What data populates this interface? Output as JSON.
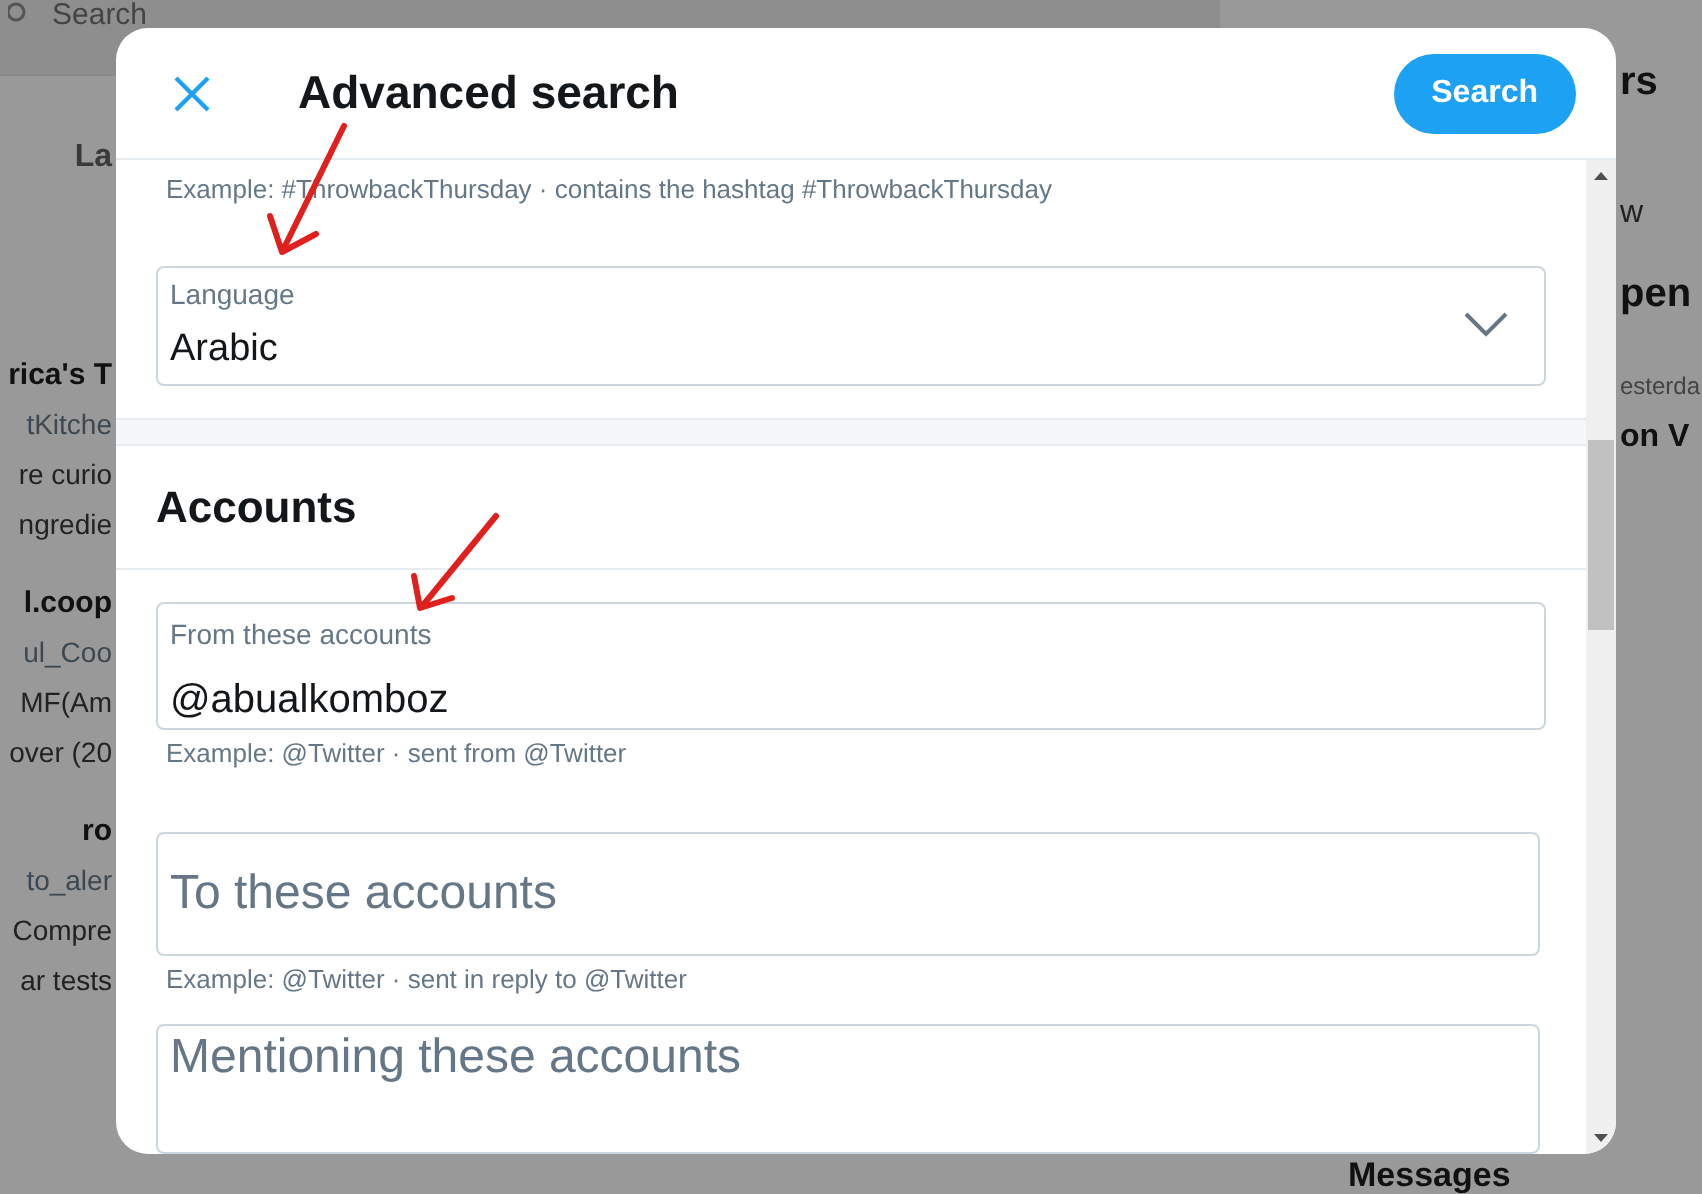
{
  "background": {
    "search_placeholder": "Search",
    "left_texts": [
      {
        "kind": "tab",
        "text": "La"
      },
      {
        "kind": "name",
        "text": "rica's T"
      },
      {
        "kind": "handle",
        "text": "tKitche"
      },
      {
        "kind": "body",
        "text": "re curio"
      },
      {
        "kind": "body",
        "text": "ngredie"
      },
      {
        "kind": "name",
        "text": "l.coop"
      },
      {
        "kind": "handle",
        "text": "ul_Coo"
      },
      {
        "kind": "body",
        "text": "MF(Am"
      },
      {
        "kind": "body",
        "text": "over (20"
      },
      {
        "kind": "verified_name",
        "text": "ro"
      },
      {
        "kind": "handle",
        "text": "to_aler"
      },
      {
        "kind": "body",
        "text": "Compre"
      },
      {
        "kind": "body",
        "text": "ar tests"
      }
    ],
    "right_texts": [
      {
        "kind": "heading",
        "text": "rs"
      },
      {
        "kind": "body",
        "text": "w"
      },
      {
        "kind": "heading",
        "text": "pen"
      },
      {
        "kind": "meta",
        "text": "esterda"
      },
      {
        "kind": "name",
        "text": "on V"
      },
      {
        "kind": "footer",
        "text": "Messages"
      }
    ]
  },
  "dialog": {
    "title": "Advanced search",
    "search_button": "Search",
    "items": [
      {
        "kind": "hint",
        "text": "Example: #ThrowbackThursday · contains the hashtag #ThrowbackThursday"
      },
      {
        "kind": "select",
        "label": "Language",
        "value": "Arabic"
      },
      {
        "kind": "heading",
        "text": "Accounts"
      },
      {
        "kind": "field",
        "label": "From these accounts",
        "value": "@abualkomboz"
      },
      {
        "kind": "hint",
        "text": "Example: @Twitter · sent from @Twitter"
      },
      {
        "kind": "field",
        "placeholder": "To these accounts"
      },
      {
        "kind": "hint",
        "text": "Example: @Twitter · sent in reply to @Twitter"
      },
      {
        "kind": "field",
        "placeholder": "Mentioning these accounts"
      }
    ]
  }
}
